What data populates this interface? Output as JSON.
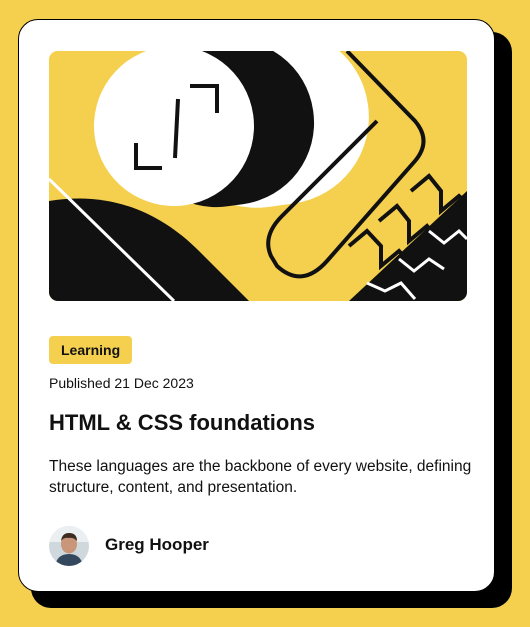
{
  "card": {
    "badge": "Learning",
    "published": "Published 21 Dec 2023",
    "title": "HTML & CSS foundations",
    "description": "These languages are the backbone of every website, defining structure, content, and presentation.",
    "author": {
      "name": "Greg Hooper"
    }
  },
  "colors": {
    "background": "#F4D04E",
    "card": "#FFFFFF",
    "ink": "#111111"
  },
  "icons": {
    "hero": "abstract-illustration",
    "avatar": "author-photo"
  }
}
